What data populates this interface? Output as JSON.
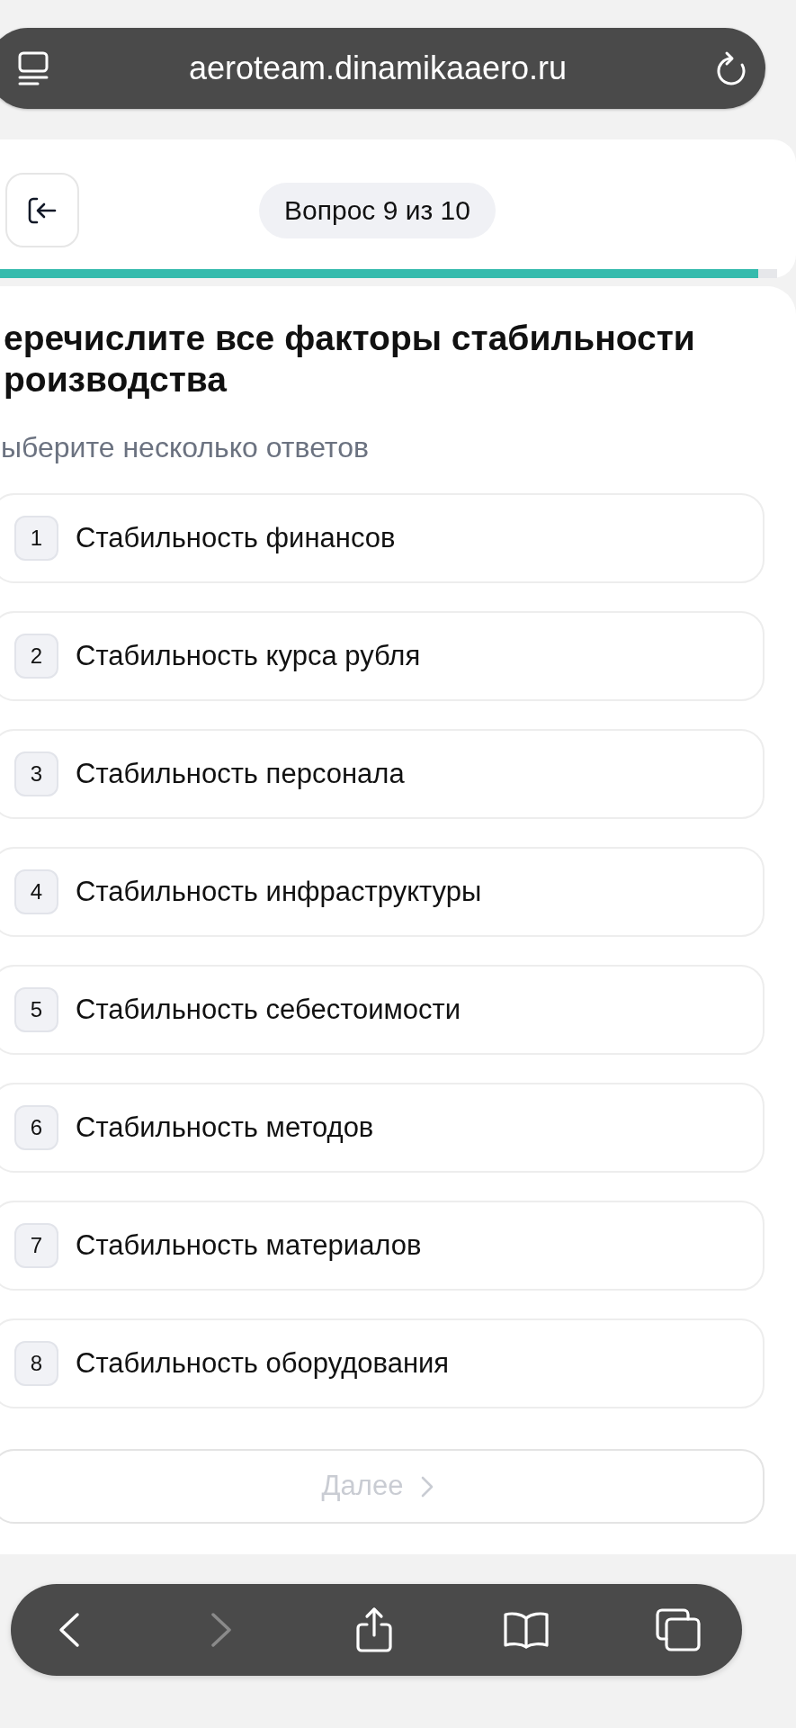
{
  "browser": {
    "url": "aeroteam.dinamikaaero.ru"
  },
  "header": {
    "counter": "Вопрос 9 из 10",
    "progress": {
      "level": 0.977
    }
  },
  "question": {
    "title": "еречислите все факторы стабильности роизводства",
    "hint": "ыберите несколько ответов"
  },
  "options": [
    {
      "number": "1",
      "label": "Стабильность финансов",
      "selected": false
    },
    {
      "number": "2",
      "label": "Стабильность курса рубля",
      "selected": false
    },
    {
      "number": "3",
      "label": "Стабильность персонала",
      "selected": false
    },
    {
      "number": "4",
      "label": "Стабильность инфраструктуры",
      "selected": false
    },
    {
      "number": "5",
      "label": "Стабильность себестоимости",
      "selected": false
    },
    {
      "number": "6",
      "label": "Стабильность методов",
      "selected": false
    },
    {
      "number": "7",
      "label": "Стабильность материалов",
      "selected": false
    },
    {
      "number": "8",
      "label": "Стабильность оборудования",
      "selected": false
    }
  ],
  "next_button": {
    "label": "Далее",
    "disabled": true
  },
  "toolbar": [
    {
      "kind": "back",
      "disabled": false
    },
    {
      "kind": "forward",
      "disabled": true
    },
    {
      "kind": "share",
      "disabled": false
    },
    {
      "kind": "bookmarks",
      "disabled": false
    },
    {
      "kind": "tabs",
      "disabled": false
    }
  ]
}
